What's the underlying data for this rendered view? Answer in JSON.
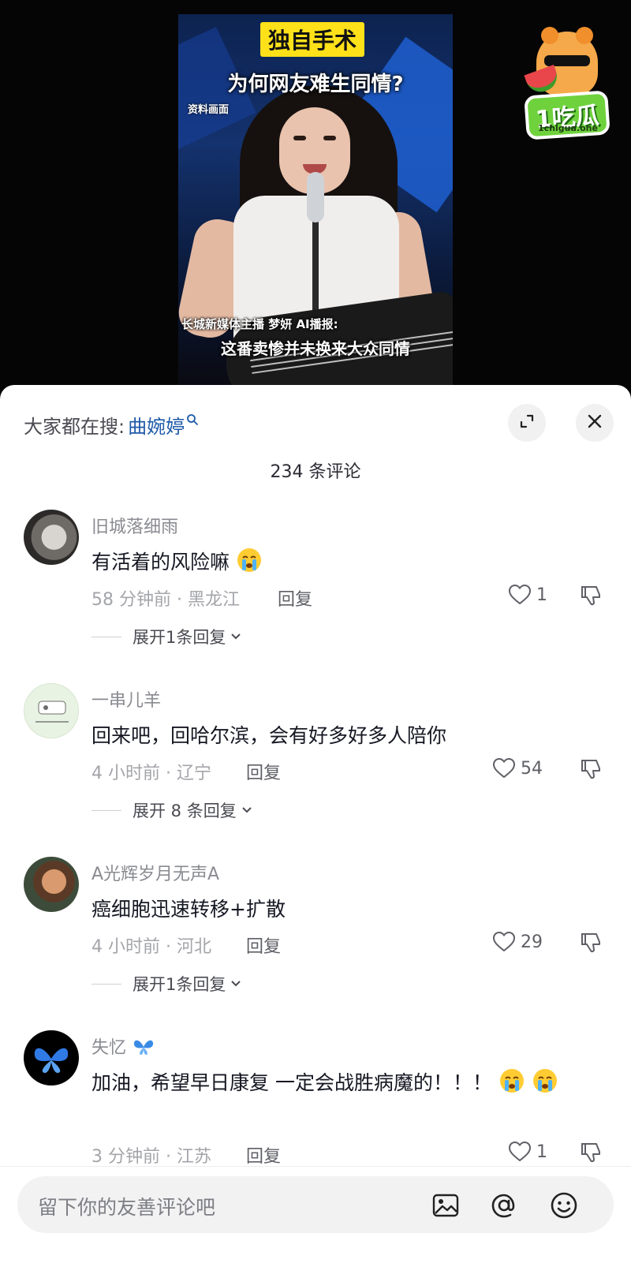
{
  "video": {
    "title_tag": "独自手术",
    "title_sub": "为何网友难生同情?",
    "source_label": "资料画面",
    "caption_line1": "长城新媒体主播 梦妍 AI播报:",
    "caption_line2": "这番卖惨并未换来大众同情",
    "logo_text": "1吃瓜",
    "logo_url": "1chigua.one"
  },
  "sheet": {
    "search_prefix": "大家都在搜:",
    "search_term": "曲婉婷",
    "comment_count": "234 条评论"
  },
  "comments": [
    {
      "name": "旧城落细雨",
      "text": "有活着的风险嘛",
      "meta": "58 分钟前 · 黑龙江",
      "reply": "回复",
      "likes": "1",
      "expand": "展开1条回复"
    },
    {
      "name": "一串儿羊",
      "text": "回来吧，回哈尔滨，会有好多好多人陪你",
      "meta": "4 小时前 · 辽宁",
      "reply": "回复",
      "likes": "54",
      "expand": "展开 8 条回复"
    },
    {
      "name": "A光辉岁月无声A",
      "text": "癌细胞迅速转移+扩散",
      "meta": "4 小时前 · 河北",
      "reply": "回复",
      "likes": "29",
      "expand": "展开1条回复"
    },
    {
      "name": "失忆",
      "text": "加油，希望早日康复 一定会战胜病魔的！！！",
      "meta": "3 分钟前 · 江苏",
      "reply": "回复",
      "likes": "1"
    }
  ],
  "input": {
    "placeholder": "留下你的友善评论吧"
  },
  "icons": {
    "image": "image-icon",
    "mention": "at-icon",
    "emoji": "emoji-icon",
    "heart": "heart-icon",
    "dislike": "thumbs-down-icon",
    "expand": "fullscreen-icon",
    "close": "close-icon"
  },
  "colors": {
    "link_blue": "#1e59a8",
    "title_yellow": "#ffe11a",
    "logo_green": "#6fd23d"
  }
}
